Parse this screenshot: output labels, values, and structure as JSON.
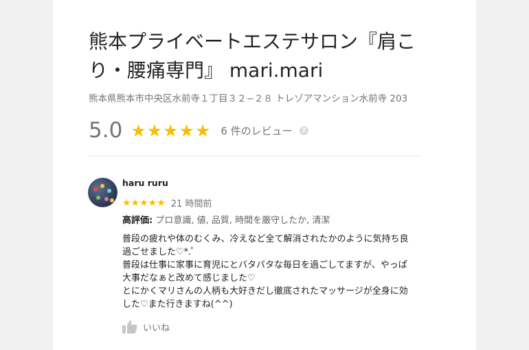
{
  "place": {
    "title_line1": "熊本プライベートエステサロン『肩こ",
    "title_line2": "り・腰痛専門』 mari.mari",
    "address": "熊本県熊本市中央区水前寺１丁目３２−２８ トレゾアマンション水前寺 203",
    "rating": "5.0",
    "stars": "★★★★★",
    "review_count": "6 件のレビュー",
    "help_glyph": "?"
  },
  "review": {
    "reviewer_name": "haru ruru",
    "stars": "★★★★★",
    "time": "21 時間前",
    "highlight_label": "高評価:",
    "highlight_values": " プロ意識, 値, 品質, 時間を厳守したか, 清潔",
    "body_lines": [
      "普段の疲れや体のむくみ、冷えなど全て解消されたかのように気持ち良",
      "過ごせました♡*.ﾟ",
      "普段は仕事に家事に育児にとバタバタな毎日を過ごしてますが、やっぱ",
      "大事だなぁと改めて感じました♡",
      "とにかくマリさんの人柄も大好きだし徹底されたマッサージが全身に効",
      "した♡また行きますね(^^)"
    ],
    "like_label": "いいね"
  },
  "colors": {
    "star": "#fbbc04",
    "muted_text": "#70757a",
    "background": "#f1f1f1",
    "card": "#ffffff"
  },
  "icons": {
    "help": "help-icon",
    "like": "thumbs-up-icon",
    "avatar": "avatar"
  }
}
